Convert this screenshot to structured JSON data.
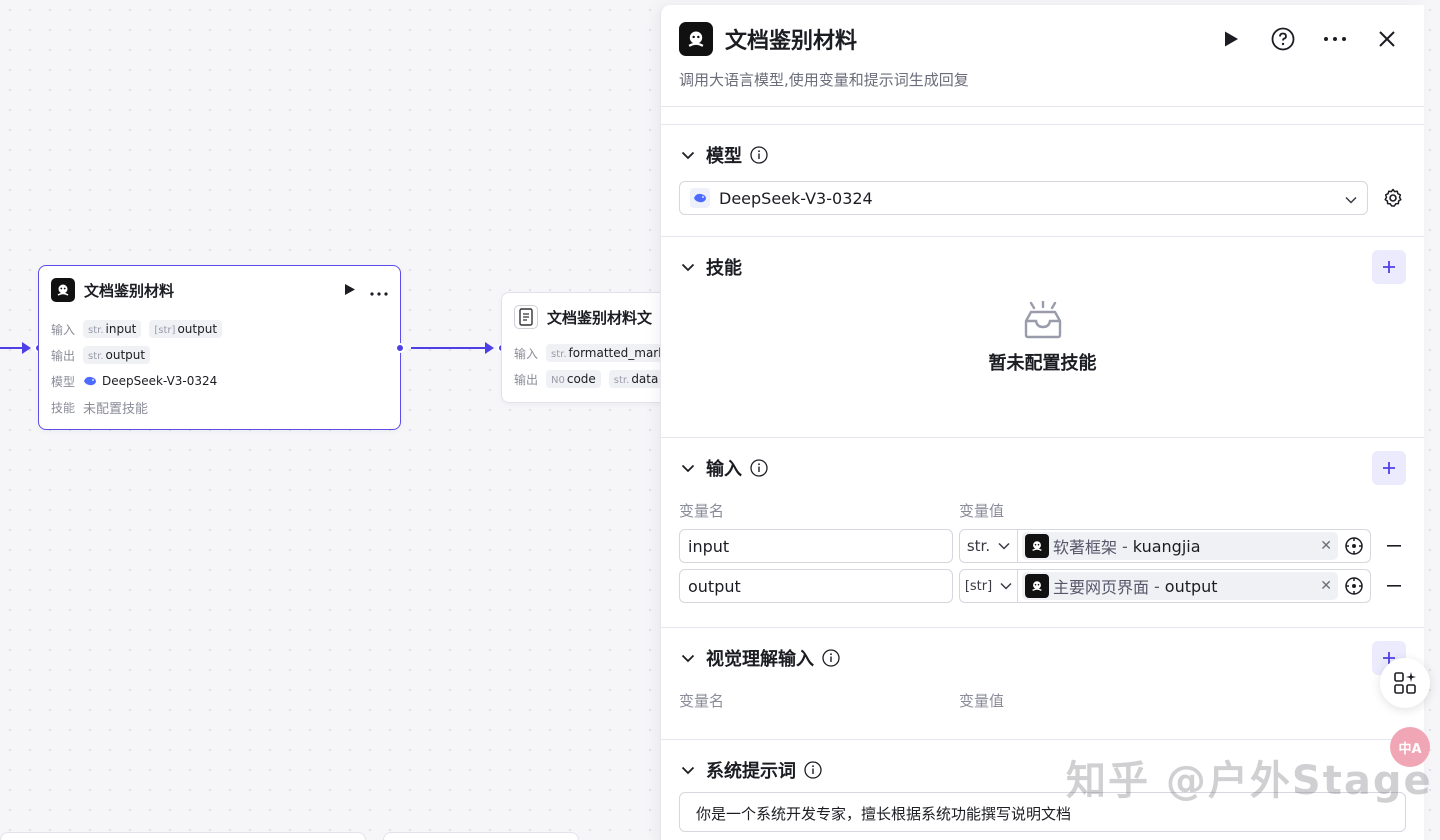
{
  "canvas": {
    "node1": {
      "title": "文档鉴别材料",
      "input_label": "输入",
      "output_label": "输出",
      "model_label": "模型",
      "skill_label": "技能",
      "inputs": [
        {
          "type": "str.",
          "name": "input"
        },
        {
          "type": "[str]",
          "name": "output"
        }
      ],
      "outputs": [
        {
          "type": "str.",
          "name": "output"
        }
      ],
      "model": "DeepSeek-V3-0324",
      "skill": "未配置技能"
    },
    "node2": {
      "title": "文档鉴别材料文",
      "input_label": "输入",
      "output_label": "输出",
      "inputs": [
        {
          "type": "str.",
          "name": "formatted_marke"
        }
      ],
      "outputs": [
        {
          "type": "N0",
          "name": "code"
        },
        {
          "type": "str.",
          "name": "data"
        }
      ]
    }
  },
  "panel": {
    "title": "文档鉴别材料",
    "description": "调用大语言模型,使用变量和提示词生成回复",
    "model_section": {
      "title": "模型",
      "selected_model": "DeepSeek-V3-0324"
    },
    "skill_section": {
      "title": "技能",
      "empty_text": "暂未配置技能"
    },
    "input_section": {
      "title": "输入",
      "col_name": "变量名",
      "col_value": "变量值",
      "rows": [
        {
          "name": "input",
          "type": "str.",
          "source_node": "软著框架",
          "source_var": "kuangjia"
        },
        {
          "name": "output",
          "type": "[str]",
          "source_node": "主要网页界面",
          "source_var": "output"
        }
      ]
    },
    "vision_section": {
      "title": "视觉理解输入",
      "col_name": "变量名",
      "col_value": "变量值"
    },
    "system_prompt_section": {
      "title": "系统提示词",
      "content": "你是一个系统开发专家，擅长根据系统功能撰写说明文档"
    }
  },
  "floating": {
    "translate_label": "中A"
  },
  "watermark": "知乎 @户外Stage",
  "colors": {
    "accent": "#4e40e5",
    "accent_light": "#eceafd",
    "border": "#d6d7df"
  }
}
